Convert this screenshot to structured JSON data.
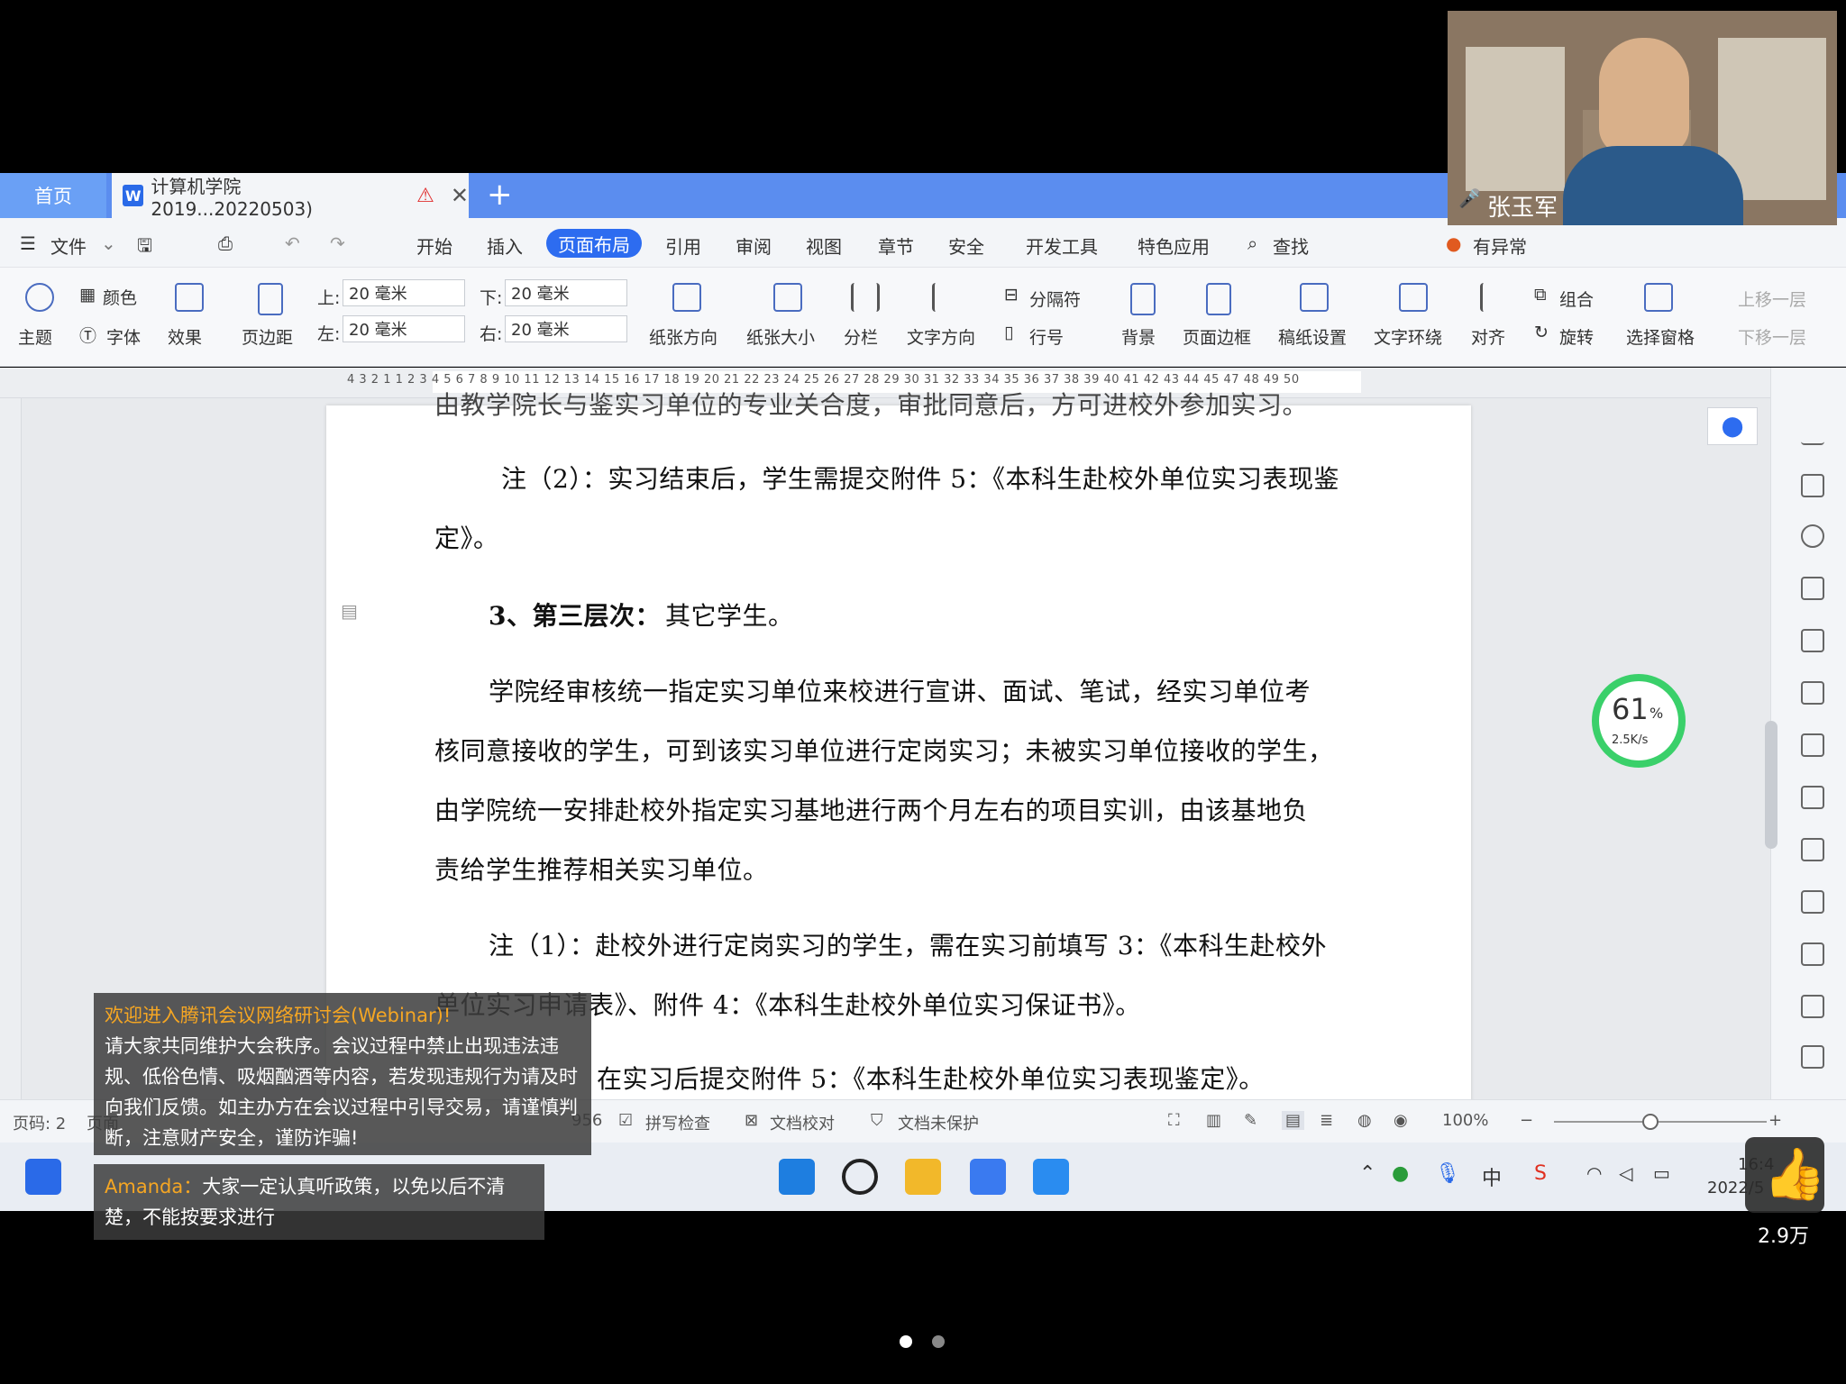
{
  "tabs": {
    "home": "首页",
    "doc_title": "计算机学院2019...20220503)",
    "plus": "+"
  },
  "menu": {
    "file": "文件",
    "items": [
      "开始",
      "插入",
      "页面布局",
      "引用",
      "审阅",
      "视图",
      "章节",
      "安全",
      "开发工具",
      "特色应用"
    ],
    "search": "查找",
    "anomaly": "有异常"
  },
  "ribbon": {
    "theme": "主题",
    "color": "颜色",
    "font": "字体",
    "effect": "效果",
    "margin": "页边距",
    "top_label": "上:",
    "top_value": "20 毫米",
    "bottom_label": "下:",
    "bottom_value": "20 毫米",
    "left_label": "左:",
    "left_value": "20 毫米",
    "right_label": "右:",
    "right_value": "20 毫米",
    "orientation": "纸张方向",
    "size": "纸张大小",
    "columns": "分栏",
    "text_dir": "文字方向",
    "separator": "分隔符",
    "line_num": "行号",
    "background": "背景",
    "page_border": "页面边框",
    "manuscript": "稿纸设置",
    "wrap": "文字环绕",
    "align": "对齐",
    "group": "组合",
    "rotate": "旋转",
    "select_pane": "选择窗格",
    "bring_up": "上移一层",
    "send_down": "下移一层"
  },
  "ruler": {
    "numbers": "4  3  2  1   1  2  3  4  5  6  7  8  9 10 11 12 13 14 15 16 17 18 19 20 21 22 23 24 25 26 27 28 29 30 31 32 33 34 35 36 37 38 39 40 41 42 43 44 45    47 48 49 50"
  },
  "document": {
    "line0": "由教学院长与鉴实习单位的专业关合度，审批同意后，方可进校外参加实习。",
    "p1a": "注（2）：实习结束后，学生需提交附件 5：《本科生赴校外单位实习表现鉴",
    "p1b": "定》。",
    "h3_bold": "3、第三层次：",
    "h3_rest": "其它学生。",
    "p2a": "学院经审核统一指定实习单位来校进行宣讲、面试、笔试，经实习单位考",
    "p2b": "核同意接收的学生，可到该实习单位进行定岗实习；未被实习单位接收的学生，",
    "p2c": "由学院统一安排赴校外指定实习基地进行两个月左右的项目实训，由该基地负",
    "p2d": "责给学生推荐相关实习单位。",
    "p3a": "注（1）：赴校外进行定岗实习的学生，需在实习前填写 3：《本科生赴校外",
    "p3b": "单位实习申请表》、附件 4：《本科生赴校外单位实习保证书》。",
    "p4": "在实习后提交附件 5：《本科生赴校外单位实习表现鉴定》。"
  },
  "status": {
    "page": "页码: 2",
    "partial": "页面",
    "count": "956",
    "spell": "拼写检查",
    "proof": "文档校对",
    "protect": "文档未保护",
    "zoom": "100%"
  },
  "speed": {
    "percent": "61",
    "unit": "%",
    "rate": "2.5K/s"
  },
  "video": {
    "speaker": "张玉军"
  },
  "chat": {
    "welcome_title": "欢迎进入腾讯会议网络研讨会(Webinar)!",
    "welcome_body": "请大家共同维护大会秩序。会议过程中禁止出现违法违规、低俗色情、吸烟酗酒等内容，若发现违规行为请及时向我们反馈。如主办方在会议过程中引导交易，请谨慎判断，注意财产安全，谨防诈骗!",
    "sender": "Amanda：",
    "message": "大家一定认真听政策，以免以后不清楚，不能按要求进行"
  },
  "taskbar": {
    "time": "16:4",
    "date": "2022/5",
    "ime": "中"
  },
  "likes": "2.9万"
}
